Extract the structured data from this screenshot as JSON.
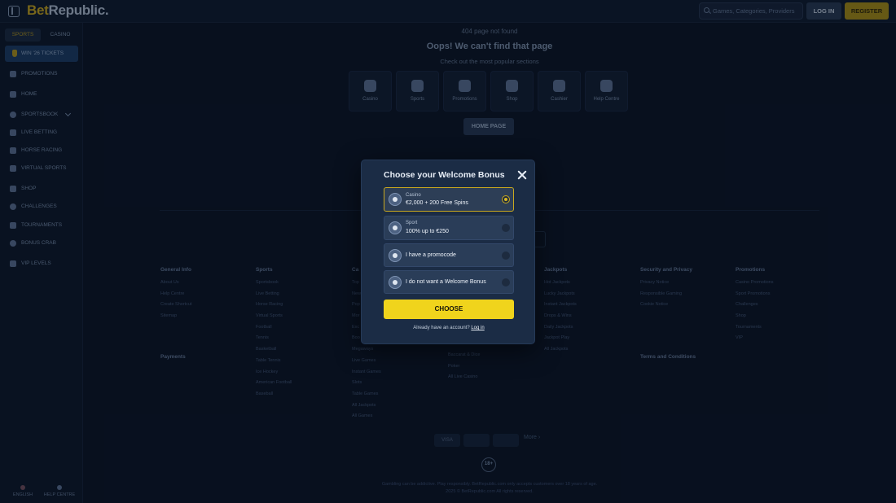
{
  "header": {
    "logo_part1": "Bet",
    "logo_part2": "Republic.",
    "search_placeholder": "Games, Categories, Providers",
    "login_label": "LOG IN",
    "register_label": "REGISTER"
  },
  "sidebar": {
    "tabs": [
      "SPORTS",
      "CASINO"
    ],
    "win_tickets": "WIN '26 TICKETS",
    "items": [
      "PROMOTIONS",
      "HOME",
      "SPORTSBOOK",
      "LIVE BETTING",
      "HORSE RACING",
      "VIRTUAL SPORTS",
      "SHOP",
      "CHALLENGES",
      "TOURNAMENTS",
      "BONUS CRAB",
      "VIP LEVELS"
    ],
    "footer": {
      "language": "ENGLISH",
      "help": "HELP CENTRE"
    }
  },
  "not_found": {
    "code": "404 page not found",
    "title": "Oops! We can't find that page",
    "subtitle": "Check out the most popular sections",
    "tiles": [
      "Casino",
      "Sports",
      "Promotions",
      "Shop",
      "Cashier",
      "Help Centre"
    ],
    "home_button": "HOME PAGE"
  },
  "footer": {
    "columns": [
      {
        "title": "General Info",
        "links": [
          "About Us",
          "Help Centre",
          "Create Shortcut",
          "Sitemap"
        ]
      },
      {
        "title": "Sports",
        "links": [
          "Sportsbook",
          "Live Betting",
          "Horse Racing",
          "Virtual Sports",
          "Football",
          "Tennis",
          "Basketball",
          "Table Tennis",
          "Ice Hockey",
          "American Football",
          "Baseball"
        ]
      },
      {
        "title": "Ca",
        "links": [
          "Top",
          "New",
          "Pop",
          "Mor",
          "Exc",
          "Boo",
          "Megaways",
          "Live Games",
          "Instant Games",
          "Slots",
          "Table Games",
          "All Jackpots",
          "All Games"
        ]
      },
      {
        "title": "",
        "links": [
          "",
          "",
          "",
          "",
          "",
          "",
          "",
          "Baccarat & Dice",
          "Poker",
          "All Live Casino"
        ]
      },
      {
        "title": "Jackpots",
        "links": [
          "Hot Jackpots",
          "Lucky Jackpots",
          "Instant Jackpots",
          "Drops & Wins",
          "Daily Jackpots",
          "Jackpot Play",
          "All Jackpots"
        ]
      },
      {
        "title": "Security and Privacy",
        "links": [
          "Privacy Notice",
          "Responsible Gaming",
          "Cookie Notice"
        ]
      },
      {
        "title": "Promotions",
        "links": [
          "Casino Promotions",
          "Sport Promotions",
          "Challenges",
          "Shop",
          "Tournaments",
          "VIP"
        ]
      }
    ],
    "payments_title": "Payments",
    "terms_title": "Terms and Conditions",
    "payment_methods": [
      "VISA",
      "mastercard",
      ""
    ],
    "more_label": "More",
    "age_badge": "18+",
    "legal_line1": "Gambling can be addictive. Play responsibly. BetRepublic.com only accepts customers over 18 years of age.",
    "legal_line2": "2025 © BetRepublic.com All rights reserved."
  },
  "modal": {
    "title": "Choose your Welcome Bonus",
    "options": [
      {
        "category": "Casino",
        "label": "€2,000 + 200 Free Spins",
        "selected": true
      },
      {
        "category": "Sport",
        "label": "100% up to €250",
        "selected": false
      },
      {
        "category": "",
        "label": "I have a promocode",
        "selected": false
      },
      {
        "category": "",
        "label": "I do not want a Welcome Bonus",
        "selected": false
      }
    ],
    "choose_button": "CHOOSE",
    "account_text": "Already have an account?",
    "login_link": "Log in"
  },
  "colors": {
    "accent_yellow": "#f0d41c",
    "selected_border": "#c9a81e",
    "modal_bg": "#1b2c45",
    "page_bg": "#0b1526"
  }
}
